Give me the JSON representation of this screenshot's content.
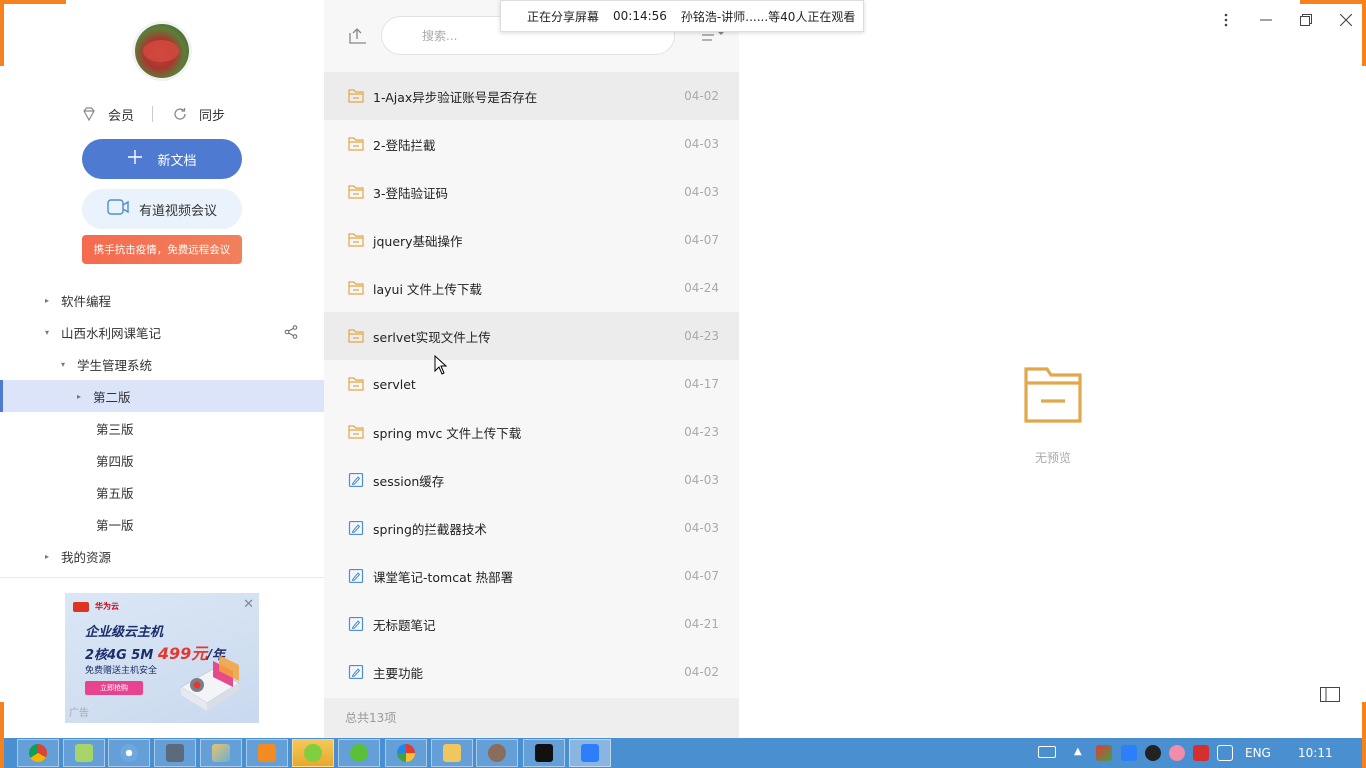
{
  "share_bar": {
    "status": "正在分享屏幕",
    "timer": "00:14:56",
    "viewers": "孙铭浩-讲师......等40人正在观看"
  },
  "sidebar": {
    "vip_label": "会员",
    "sync_label": "同步",
    "new_doc_label": "新文档",
    "meeting_label": "有道视频会议",
    "promo_text": "携手抗击疫情，免费远程会议",
    "tree": [
      {
        "label": "软件编程",
        "level": 0,
        "arrow": "▸"
      },
      {
        "label": "山西水利网课笔记",
        "level": 0,
        "arrow": "▾"
      },
      {
        "label": "学生管理系统",
        "level": 1,
        "arrow": "▾"
      },
      {
        "label": "第二版",
        "level": 2,
        "arrow": "▸"
      },
      {
        "label": "第三版",
        "level": 2,
        "arrow": ""
      },
      {
        "label": "第四版",
        "level": 2,
        "arrow": ""
      },
      {
        "label": "第五版",
        "level": 2,
        "arrow": ""
      },
      {
        "label": "第一版",
        "level": 2,
        "arrow": ""
      },
      {
        "label": "我的资源",
        "level": 0,
        "arrow": "▸"
      }
    ],
    "ad": {
      "brand": "华为云",
      "title": "企业级云主机",
      "spec": "2核4G 5M",
      "price": "499元",
      "unit": "/年",
      "subtitle": "免费赠送主机安全",
      "cta": "立即抢购",
      "tag": "广告"
    }
  },
  "file_list": {
    "search_placeholder": "搜索...",
    "items": [
      {
        "name": "1-Ajax异步验证账号是否存在",
        "date": "04-02",
        "type": "folder"
      },
      {
        "name": "2-登陆拦截",
        "date": "04-03",
        "type": "folder"
      },
      {
        "name": "3-登陆验证码",
        "date": "04-03",
        "type": "folder"
      },
      {
        "name": "jquery基础操作",
        "date": "04-07",
        "type": "folder"
      },
      {
        "name": "layui 文件上传下载",
        "date": "04-24",
        "type": "folder"
      },
      {
        "name": "serlvet实现文件上传",
        "date": "04-23",
        "type": "folder"
      },
      {
        "name": "servlet",
        "date": "04-17",
        "type": "folder"
      },
      {
        "name": "spring mvc 文件上传下载",
        "date": "04-23",
        "type": "folder"
      },
      {
        "name": "session缓存",
        "date": "04-03",
        "type": "note"
      },
      {
        "name": "spring的拦截器技术",
        "date": "04-03",
        "type": "note"
      },
      {
        "name": "课堂笔记-tomcat 热部署",
        "date": "04-07",
        "type": "note"
      },
      {
        "name": "无标题笔记",
        "date": "04-21",
        "type": "note"
      },
      {
        "name": "主要功能",
        "date": "04-02",
        "type": "note"
      }
    ],
    "total": "总共13项"
  },
  "preview": {
    "empty_text": "无预览"
  },
  "taskbar": {
    "lang": "ENG",
    "clock": "10:11"
  },
  "colors": {
    "accent": "#4e7ad1",
    "folder": "#e0a84a",
    "note": "#4a8fd0",
    "taskbar": "#4a8fd0"
  }
}
